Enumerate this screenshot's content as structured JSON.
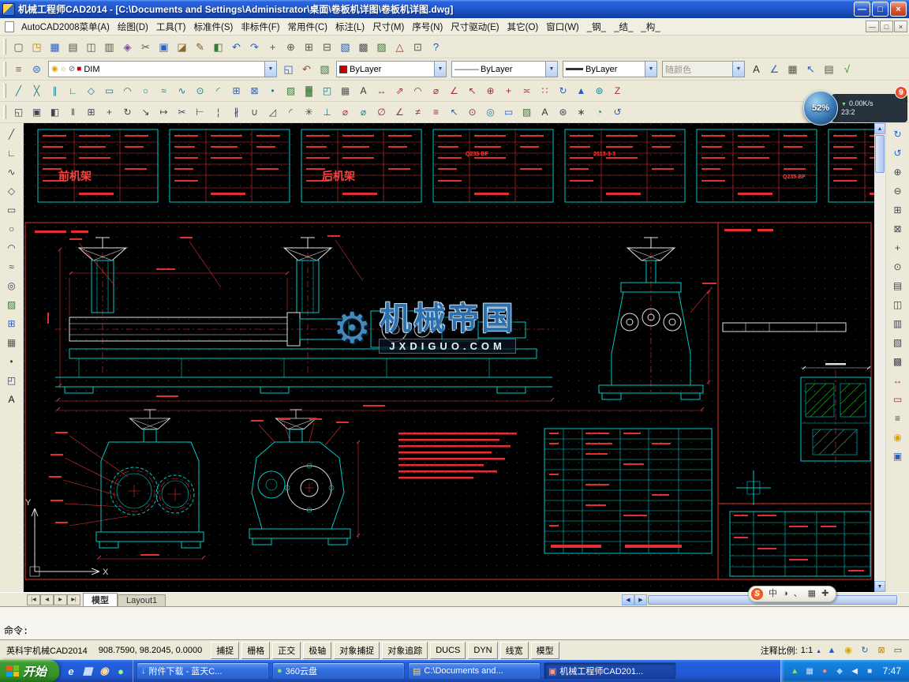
{
  "titlebar": {
    "title": "机械工程师CAD2014 - [C:\\Documents and Settings\\Administrator\\桌面\\卷板机详图\\卷板机详图.dwg]",
    "minimize": "—",
    "restore": "□",
    "close": "×"
  },
  "menubar": {
    "items": [
      {
        "label": "AutoCAD2008菜单(A)"
      },
      {
        "label": "绘图(D)"
      },
      {
        "label": "工具(T)"
      },
      {
        "label": "标准件(S)"
      },
      {
        "label": "非标件(F)"
      },
      {
        "label": "常用件(C)"
      },
      {
        "label": "标注(L)"
      },
      {
        "label": "尺寸(M)"
      },
      {
        "label": "序号(N)"
      },
      {
        "label": "尺寸驱动(E)"
      },
      {
        "label": "其它(O)"
      },
      {
        "label": "窗口(W)"
      },
      {
        "label": "_钢_"
      },
      {
        "label": "_结_"
      },
      {
        "label": "_构_"
      }
    ],
    "mdi_minimize": "—",
    "mdi_restore": "□",
    "mdi_close": "×"
  },
  "toolbar1": {
    "icons": [
      {
        "glyph": "▢",
        "name": "new-file-icon",
        "color": "#555555"
      },
      {
        "glyph": "◳",
        "name": "open-file-icon",
        "color": "#b8860b"
      },
      {
        "glyph": "▦",
        "name": "save-icon",
        "color": "#2b5fc0"
      },
      {
        "glyph": "▤",
        "name": "plot-icon",
        "color": "#555555"
      },
      {
        "glyph": "◫",
        "name": "print-preview-icon",
        "color": "#555555"
      },
      {
        "glyph": "▥",
        "name": "publish-icon",
        "color": "#555555"
      },
      {
        "glyph": "◈",
        "name": "dwf-icon",
        "color": "#7a4a9a"
      },
      {
        "glyph": "✂",
        "name": "cut-icon",
        "color": "#555555"
      },
      {
        "glyph": "▣",
        "name": "copy-icon",
        "color": "#2b5fc0"
      },
      {
        "glyph": "◪",
        "name": "paste-icon",
        "color": "#8a6a2a"
      },
      {
        "glyph": "✎",
        "name": "match-properties-icon",
        "color": "#8a5a2b"
      },
      {
        "glyph": "◧",
        "name": "block-editor-icon",
        "color": "#3a7a3a"
      },
      {
        "glyph": "↶",
        "name": "undo-icon",
        "color": "#2b5fc0"
      },
      {
        "glyph": "↷",
        "name": "redo-icon",
        "color": "#2b5fc0"
      },
      {
        "glyph": "+",
        "name": "pan-icon",
        "color": "#555555"
      },
      {
        "glyph": "⊕",
        "name": "zoom-realtime-icon",
        "color": "#555555"
      },
      {
        "glyph": "⊞",
        "name": "zoom-window-icon",
        "color": "#555555"
      },
      {
        "glyph": "⊟",
        "name": "zoom-previous-icon",
        "color": "#555555"
      },
      {
        "glyph": "▧",
        "name": "properties-icon",
        "color": "#2b5fc0"
      },
      {
        "glyph": "▩",
        "name": "design-center-icon",
        "color": "#555555"
      },
      {
        "glyph": "▨",
        "name": "tool-palettes-icon",
        "color": "#3a7a3a"
      },
      {
        "glyph": "△",
        "name": "markup-icon",
        "color": "#b03030"
      },
      {
        "glyph": "⊡",
        "name": "calculator-icon",
        "color": "#555555"
      },
      {
        "glyph": "?",
        "name": "help-icon",
        "color": "#1a56c4"
      }
    ]
  },
  "toolbar2": {
    "left_icons": [
      {
        "glyph": "≡",
        "name": "layer-properties-icon",
        "color": "#8a6a2a"
      },
      {
        "glyph": "⊜",
        "name": "layer-states-icon",
        "color": "#2b5fc0"
      }
    ],
    "layer_state_icons": [
      {
        "glyph": "◉",
        "name": "layer-on-icon",
        "color": "#d8a500"
      },
      {
        "glyph": "☼",
        "name": "layer-freeze-icon",
        "color": "#d8a500"
      },
      {
        "glyph": "⊘",
        "name": "layer-lock-icon",
        "color": "#4a6a9a"
      },
      {
        "glyph": "■",
        "name": "layer-color-chip",
        "color": "#c00000"
      }
    ],
    "layer_value": "DIM",
    "mid_icons": [
      {
        "glyph": "◱",
        "name": "make-layer-current-icon",
        "color": "#2b5fc0"
      },
      {
        "glyph": "↶",
        "name": "layer-previous-icon",
        "color": "#7a5230"
      },
      {
        "glyph": "▧",
        "name": "layer-filter-icon",
        "color": "#4a7a4a"
      }
    ],
    "color_value": "ByLayer",
    "linetype_sample": "———",
    "linetype_value": "ByLayer",
    "lineweight_value": "ByLayer",
    "plotstyle_value": "随颜色",
    "right_icons": [
      {
        "glyph": "A",
        "name": "text-style-icon",
        "color": "#333333"
      },
      {
        "glyph": "∠",
        "name": "dim-style-icon",
        "color": "#2b5fc0"
      },
      {
        "glyph": "▦",
        "name": "table-style-icon",
        "color": "#555555"
      },
      {
        "glyph": "↖",
        "name": "mleader-style-icon",
        "color": "#2b5fc0"
      },
      {
        "glyph": "▤",
        "name": "plot-style-icon",
        "color": "#555555"
      },
      {
        "glyph": "√",
        "name": "standards-icon",
        "color": "#2f8a1f"
      }
    ]
  },
  "toolbar3": {
    "icons": [
      {
        "glyph": "╱",
        "name": "line-icon"
      },
      {
        "glyph": "╳",
        "name": "construction-line-icon"
      },
      {
        "glyph": "∥",
        "name": "multiline-icon"
      },
      {
        "glyph": "∟",
        "name": "polyline-icon"
      },
      {
        "glyph": "◇",
        "name": "polygon-icon"
      },
      {
        "glyph": "▭",
        "name": "rectangle-icon"
      },
      {
        "glyph": "◠",
        "name": "arc-icon"
      },
      {
        "glyph": "○",
        "name": "circle-icon"
      },
      {
        "glyph": "≈",
        "name": "revision-cloud-icon"
      },
      {
        "glyph": "∿",
        "name": "spline-icon"
      },
      {
        "glyph": "⊙",
        "name": "ellipse-icon"
      },
      {
        "glyph": "◜",
        "name": "ellipse-arc-icon"
      },
      {
        "glyph": "⊞",
        "name": "insert-block-icon",
        "color": "#2b5fc0"
      },
      {
        "glyph": "⊠",
        "name": "make-block-icon",
        "color": "#2b5fc0"
      },
      {
        "glyph": "•",
        "name": "point-icon"
      },
      {
        "glyph": "▨",
        "name": "hatch-icon",
        "color": "#3a7a3a"
      },
      {
        "glyph": "▓",
        "name": "gradient-icon",
        "color": "#3a7a3a"
      },
      {
        "glyph": "◰",
        "name": "region-icon"
      },
      {
        "glyph": "▦",
        "name": "table-icon",
        "color": "#555555"
      },
      {
        "glyph": "A",
        "name": "mtext-icon",
        "color": "#333333"
      },
      {
        "glyph": "↔",
        "name": "dim-linear-icon",
        "color": "#a03030"
      },
      {
        "glyph": "⇗",
        "name": "dim-aligned-icon",
        "color": "#a03030"
      },
      {
        "glyph": "◠",
        "name": "dim-arc-icon",
        "color": "#a03030"
      },
      {
        "glyph": "⌀",
        "name": "dim-diameter-icon",
        "color": "#a03030"
      },
      {
        "glyph": "∠",
        "name": "dim-angular-icon",
        "color": "#a03030"
      },
      {
        "glyph": "↖",
        "name": "leader-icon",
        "color": "#a03030"
      },
      {
        "glyph": "⊕",
        "name": "tolerance-icon",
        "color": "#a03030"
      },
      {
        "glyph": "+",
        "name": "center-mark-icon",
        "color": "#a03030"
      },
      {
        "glyph": "≍",
        "name": "dim-baseline-icon",
        "color": "#a03030"
      },
      {
        "glyph": "∷",
        "name": "dim-continue-icon",
        "color": "#a03030"
      },
      {
        "glyph": "↻",
        "name": "dim-update-icon",
        "color": "#2b5fc0"
      },
      {
        "glyph": "▲",
        "name": "dim-style-button-icon",
        "color": "#2b5fc0"
      },
      {
        "glyph": "⊚",
        "name": "inspection-icon"
      },
      {
        "glyph": "Z",
        "name": "dim-jog-icon",
        "color": "#a03030"
      }
    ]
  },
  "toolbar4": {
    "icons": [
      {
        "glyph": "◱",
        "name": "erase-icon"
      },
      {
        "glyph": "▣",
        "name": "copy-object-icon"
      },
      {
        "glyph": "◧",
        "name": "mirror-icon"
      },
      {
        "glyph": "‖",
        "name": "offset-icon"
      },
      {
        "glyph": "⊞",
        "name": "array-icon"
      },
      {
        "glyph": "+",
        "name": "move-icon"
      },
      {
        "glyph": "↻",
        "name": "rotate-icon"
      },
      {
        "glyph": "↘",
        "name": "scale-icon"
      },
      {
        "glyph": "↦",
        "name": "stretch-icon"
      },
      {
        "glyph": "✂",
        "name": "trim-icon"
      },
      {
        "glyph": "⊢",
        "name": "extend-icon"
      },
      {
        "glyph": "¦",
        "name": "break-at-point-icon"
      },
      {
        "glyph": "∦",
        "name": "break-icon"
      },
      {
        "glyph": "∪",
        "name": "join-icon"
      },
      {
        "glyph": "◿",
        "name": "chamfer-icon"
      },
      {
        "glyph": "◜",
        "name": "fillet-icon"
      },
      {
        "glyph": "✳",
        "name": "explode-icon"
      },
      {
        "glyph": "⊥",
        "name": "perpendicular-icon",
        "color": "#1f7a8a"
      },
      {
        "glyph": "⌀",
        "name": "diameter-symbol-icon",
        "color": "#a03030"
      },
      {
        "glyph": "⌀",
        "name": "diameter-symbol-cyan-icon",
        "color": "#1f7a8a"
      },
      {
        "glyph": "∅",
        "name": "empty-set-icon",
        "color": "#a03030"
      },
      {
        "glyph": "∠",
        "name": "angle-symbol-icon",
        "color": "#a03030"
      },
      {
        "glyph": "≠",
        "name": "dim-break-icon",
        "color": "#a03030"
      },
      {
        "glyph": "≡",
        "name": "dim-space-icon",
        "color": "#a03030"
      },
      {
        "glyph": "↖",
        "name": "multileader-icon",
        "color": "#2b5fc0"
      },
      {
        "glyph": "⊙",
        "name": "dim-radius-icon",
        "color": "#a03030"
      },
      {
        "glyph": "◎",
        "name": "donut-icon",
        "color": "#1f7a8a"
      },
      {
        "glyph": "▭",
        "name": "viewport-icon",
        "color": "#2b5fc0"
      },
      {
        "glyph": "▨",
        "name": "hatch-edit-icon",
        "color": "#3a7a3a"
      },
      {
        "glyph": "A",
        "name": "edit-text-icon",
        "color": "#333333"
      },
      {
        "glyph": "⊛",
        "name": "divide-icon"
      },
      {
        "glyph": "∗",
        "name": "measure-icon"
      },
      {
        "glyph": "◔",
        "name": "arc-edit-icon",
        "color": "#1f7a8a"
      },
      {
        "glyph": "↺",
        "name": "undo-mark-icon",
        "color": "#2b5fc0"
      }
    ]
  },
  "left_toolbar": {
    "icons": [
      {
        "glyph": "╱",
        "name": "line-tool-icon"
      },
      {
        "glyph": "∟",
        "name": "polyline-tool-icon"
      },
      {
        "glyph": "∿",
        "name": "spline-tool-icon"
      },
      {
        "glyph": "◇",
        "name": "polygon-tool-icon"
      },
      {
        "glyph": "▭",
        "name": "rectangle-tool-icon"
      },
      {
        "glyph": "○",
        "name": "circle-tool-icon"
      },
      {
        "glyph": "◠",
        "name": "arc-tool-icon"
      },
      {
        "glyph": "≈",
        "name": "cloud-tool-icon"
      },
      {
        "glyph": "◎",
        "name": "donut-tool-icon"
      },
      {
        "glyph": "▨",
        "name": "hatch-tool-icon",
        "color": "#3a7a3a"
      },
      {
        "glyph": "⊞",
        "name": "block-tool-icon",
        "color": "#2b5fc0"
      },
      {
        "glyph": "▦",
        "name": "table-tool-icon",
        "color": "#555555"
      },
      {
        "glyph": "•",
        "name": "point-tool-icon"
      },
      {
        "glyph": "◰",
        "name": "region-tool-icon"
      },
      {
        "glyph": "A",
        "name": "text-tool-icon",
        "color": "#111111"
      }
    ]
  },
  "right_toolbar": {
    "icons": [
      {
        "glyph": "↻",
        "name": "redraw-icon",
        "color": "#2b5fc0"
      },
      {
        "glyph": "↺",
        "name": "regen-icon",
        "color": "#2b5fc0"
      },
      {
        "glyph": "⊕",
        "name": "zoom-in-icon"
      },
      {
        "glyph": "⊖",
        "name": "zoom-out-icon"
      },
      {
        "glyph": "⊞",
        "name": "zoom-window-tool-icon"
      },
      {
        "glyph": "⊠",
        "name": "zoom-extents-icon"
      },
      {
        "glyph": "+",
        "name": "pan-tool-icon"
      },
      {
        "glyph": "⊙",
        "name": "orbit-icon"
      },
      {
        "glyph": "▤",
        "name": "named-views-icon"
      },
      {
        "glyph": "◫",
        "name": "viewports-icon"
      },
      {
        "glyph": "▥",
        "name": "hide-icon"
      },
      {
        "glyph": "▧",
        "name": "shade-icon"
      },
      {
        "glyph": "▩",
        "name": "render-icon"
      },
      {
        "glyph": "↔",
        "name": "distance-icon",
        "color": "#a03030"
      },
      {
        "glyph": "▭",
        "name": "area-icon",
        "color": "#a03030"
      },
      {
        "glyph": "≡",
        "name": "list-icon"
      },
      {
        "glyph": "◉",
        "name": "id-point-icon",
        "color": "#d8a500"
      },
      {
        "glyph": "▣",
        "name": "properties-panel-icon",
        "color": "#2b5fc0"
      }
    ]
  },
  "canvas": {
    "watermark_gear": "⚙",
    "watermark_brand": "机械帝国",
    "watermark_domain": "JXDIGUO.COM",
    "labels": {
      "front_frame": "前机架",
      "rear_frame": "后机架",
      "material": "Q235-BF",
      "date": "2013-3-3"
    },
    "ucs": {
      "x": "X",
      "y": "Y"
    }
  },
  "speedball": {
    "percent": "52%",
    "down_speed": "0.00K/s",
    "counter": "23:2",
    "badge": "9"
  },
  "sogou": {
    "logo": "S",
    "items": [
      {
        "glyph": "中",
        "name": "sogou-lang-icon"
      },
      {
        "glyph": "◑",
        "name": "sogou-fullwidth-icon"
      },
      {
        "glyph": "、",
        "name": "sogou-punct-icon"
      },
      {
        "glyph": "▦",
        "name": "sogou-keyboard-icon"
      },
      {
        "glyph": "✚",
        "name": "sogou-toolbox-icon"
      }
    ]
  },
  "tabs": {
    "nav": [
      {
        "glyph": "|◀"
      },
      {
        "glyph": "◀"
      },
      {
        "glyph": "▶"
      },
      {
        "glyph": "▶|"
      }
    ],
    "items": [
      {
        "label": "模型",
        "cls": "active"
      },
      {
        "label": "Layout1",
        "cls": ""
      }
    ]
  },
  "command": {
    "history": "",
    "prompt": "命令:"
  },
  "statusbar": {
    "app_label": "英科宇机械CAD2014",
    "coords": "908.7590, 98.2045, 0.0000",
    "toggles": [
      {
        "label": "捕捉"
      },
      {
        "label": "栅格"
      },
      {
        "label": "正交"
      },
      {
        "label": "极轴"
      },
      {
        "label": "对象捕捉"
      },
      {
        "label": "对象追踪"
      },
      {
        "label": "DUCS"
      },
      {
        "label": "DYN"
      },
      {
        "label": "线宽"
      },
      {
        "label": "模型"
      }
    ],
    "scale_label": "注释比例:",
    "scale_value": "1:1",
    "right_icons": [
      {
        "glyph": "▲",
        "name": "annotation-scale-icon",
        "color": "#2b5fc0"
      },
      {
        "glyph": "◉",
        "name": "annotation-visibility-icon",
        "color": "#d8a500"
      },
      {
        "glyph": "↻",
        "name": "annotation-update-icon",
        "color": "#2b5fc0"
      },
      {
        "glyph": "⊠",
        "name": "toolbar-lock-icon",
        "color": "#b8860b"
      },
      {
        "glyph": "▭",
        "name": "clean-screen-icon",
        "color": "#444444"
      }
    ]
  },
  "taskbar": {
    "start_label": "开始",
    "quick_launch": [
      {
        "glyph": "e",
        "name": "ie-quicklaunch-icon",
        "color": "#e8f4ff"
      },
      {
        "glyph": "▦",
        "name": "show-desktop-icon",
        "color": "#d8e8ff"
      },
      {
        "glyph": "◉",
        "name": "media-player-icon",
        "color": "#ffd9a0"
      },
      {
        "glyph": "●",
        "name": "browser-360-icon",
        "color": "#a8f080"
      }
    ],
    "tasks": [
      {
        "label": "附件下载 - 蓝天C...",
        "glyph": "↓",
        "color": "#cfe8ff",
        "cls": ""
      },
      {
        "label": "360云盘",
        "glyph": "●",
        "color": "#8fe06a",
        "cls": ""
      },
      {
        "label": "C:\\Documents and...",
        "glyph": "▤",
        "color": "#ffd97a",
        "cls": ""
      },
      {
        "label": "机械工程师CAD201...",
        "glyph": "▣",
        "color": "#ff9a7a",
        "cls": "active"
      }
    ],
    "tray_icons": [
      {
        "glyph": "▲",
        "name": "tray-download-icon",
        "color": "#8fe06a"
      },
      {
        "glyph": "▦",
        "name": "tray-input-icon",
        "color": "#cfe0ff"
      },
      {
        "glyph": "●",
        "name": "tray-antivirus-icon",
        "color": "#ff8a6a"
      },
      {
        "glyph": "◆",
        "name": "tray-security-icon",
        "color": "#9fd0ff"
      },
      {
        "glyph": "◀",
        "name": "tray-volume-icon",
        "color": "#e8f0ff"
      },
      {
        "glyph": "■",
        "name": "tray-network-icon",
        "color": "#cfe0ff"
      }
    ],
    "time": "7:47"
  }
}
